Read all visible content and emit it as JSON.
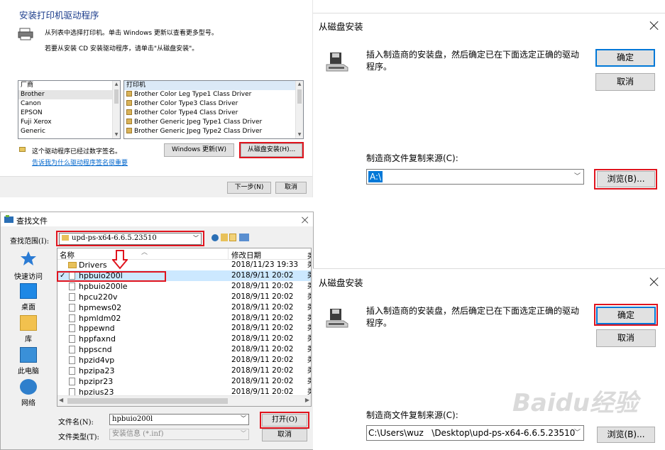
{
  "wizard": {
    "title": "安装打印机驱动程序",
    "instruction1": "从列表中选择打印机。单击 Windows 更新以查看更多型号。",
    "instruction2": "若要从安装 CD 安装驱动程序，请单击\"从磁盘安装\"。",
    "manufacturer_header": "厂商",
    "manufacturers": [
      "Brother",
      "Canon",
      "EPSON",
      "Fuji Xerox",
      "Generic"
    ],
    "manufacturer_selected": "Brother",
    "printer_header": "打印机",
    "printers": [
      "Brother Color Leg Type1 Class Driver",
      "Brother Color Type3 Class Driver",
      "Brother Color Type4 Class Driver",
      "Brother Generic Jpeg Type1 Class Driver",
      "Brother Generic Jpeg Type2 Class Driver"
    ],
    "signed_text": "这个驱动程序已经过数字签名。",
    "signing_link": "告诉我为什么驱动程序签名很重要",
    "windows_update_button": "Windows 更新(W)",
    "have_disk_button": "从磁盘安装(H)...",
    "next_button": "下一步(N)",
    "cancel_button": "取消"
  },
  "install_disk_top": {
    "title": "从磁盘安装",
    "message": "插入制造商的安装盘，然后确定已在下面选定正确的驱动程序。",
    "ok_button": "确定",
    "cancel_button": "取消",
    "copy_from_label": "制造商文件复制来源(C):",
    "copy_from_value": "A:\\",
    "browse_button": "浏览(B)..."
  },
  "find_file": {
    "title": "查找文件",
    "look_in_label": "查找范围(I):",
    "look_in_value": "upd-ps-x64-6.6.5.23510",
    "col_name": "名称",
    "col_modified": "修改日期",
    "col_cut": "类",
    "places": [
      "快速访问",
      "桌面",
      "库",
      "此电脑",
      "网络"
    ],
    "files": [
      {
        "name": "Drivers",
        "date": "2018/11/23 19:33",
        "type": "folder"
      },
      {
        "name": "hpbuio200l",
        "date": "2018/9/11 20:02",
        "type": "file"
      },
      {
        "name": "hpbuio200le",
        "date": "2018/9/11 20:02",
        "type": "file"
      },
      {
        "name": "hpcu220v",
        "date": "2018/9/11 20:02",
        "type": "file"
      },
      {
        "name": "hpmews02",
        "date": "2018/9/11 20:02",
        "type": "file"
      },
      {
        "name": "hpmldm02",
        "date": "2018/9/11 20:02",
        "type": "file"
      },
      {
        "name": "hppewnd",
        "date": "2018/9/11 20:02",
        "type": "file"
      },
      {
        "name": "hppfaxnd",
        "date": "2018/9/11 20:02",
        "type": "file"
      },
      {
        "name": "hppscnd",
        "date": "2018/9/11 20:02",
        "type": "file"
      },
      {
        "name": "hpzid4vp",
        "date": "2018/9/11 20:02",
        "type": "file"
      },
      {
        "name": "hpzipa23",
        "date": "2018/9/11 20:02",
        "type": "file"
      },
      {
        "name": "hpzipr23",
        "date": "2018/9/11 20:02",
        "type": "file"
      },
      {
        "name": "hpzius23",
        "date": "2018/9/11 20:02",
        "type": "file"
      }
    ],
    "filename_label": "文件名(N):",
    "filename_value": "hpbuio200l",
    "filetype_label": "文件类型(T):",
    "filetype_value": "安装信息 (*.inf)",
    "open_button": "打开(O)",
    "cancel_button": "取消"
  },
  "install_disk_bottom": {
    "title": "从磁盘安装",
    "message": "插入制造商的安装盘，然后确定已在下面选定正确的驱动程序。",
    "ok_button": "确定",
    "cancel_button": "取消",
    "copy_from_label": "制造商文件复制来源(C):",
    "copy_from_value": "C:\\Users\\wuz   \\Desktop\\upd-ps-x64-6.6.5.23510",
    "browse_button": "浏览(B)..."
  },
  "watermark": "Baidu经验",
  "colors": {
    "highlight_red": "#e0141e",
    "accent_blue": "#0078d7",
    "title_blue": "#1c3d8c"
  }
}
